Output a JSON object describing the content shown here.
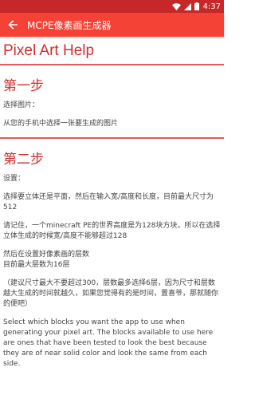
{
  "status_bar": {
    "time": "4:37"
  },
  "app_bar": {
    "title": "MCPE像素画生成器"
  },
  "page": {
    "title": "Pixel Art Help"
  },
  "step1": {
    "heading": "第一步",
    "label": "选择图片：",
    "text": "从您的手机中选择一张要生成的图片"
  },
  "step2": {
    "heading": "第二步",
    "settings_label": "设置：",
    "p1": "选择要立体还是平面，然后在输入宽/高度和长度，目前最大尺寸为512",
    "p2": "请记住，一个minecraft PE的世界高度是为128块方块，所以在选择立体生成的时候宽/高度不能够超过128",
    "p3_line1": "然后在设置好像素画的层数",
    "p3_line2": "目前最大层数为16层",
    "p4": "（建议尺寸最大不要超过300，层数最多选择6层，因为尺寸和层数越大生成的时间就越久，如果您觉得有的是时间，置喜爷，那就随你的便吧）",
    "p5": "Select which blocks you want the app to use when generating your pixel art. The blocks available to use here are ones that have been tested to look the best because they are of near solid color and look the same from each side."
  }
}
